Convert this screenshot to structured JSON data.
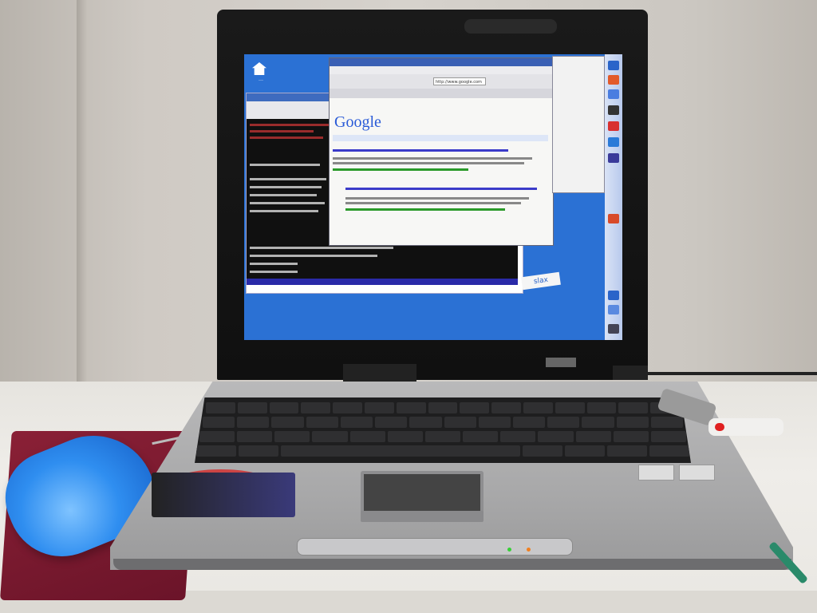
{
  "scene": {
    "screen": {
      "desktop_icon": {
        "icon": "home-icon"
      },
      "firefox": {
        "logo": "Google",
        "url": "http://www.google.com"
      },
      "slax_label": "slax"
    }
  }
}
